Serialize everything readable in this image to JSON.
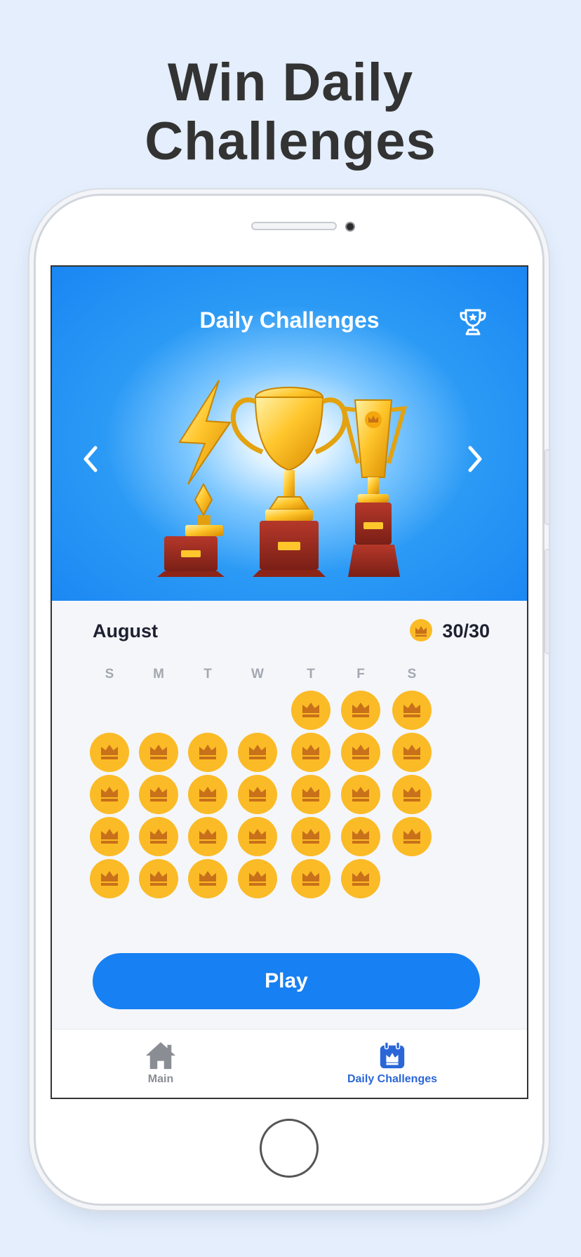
{
  "headline": {
    "line1": "Win Daily",
    "line2": "Challenges"
  },
  "screen": {
    "title": "Daily Challenges",
    "header_icon": "trophy-icon",
    "nav_prev_icon": "chevron-left-icon",
    "nav_next_icon": "chevron-right-icon"
  },
  "calendar": {
    "month": "August",
    "score": "30/30",
    "score_icon": "crown-coin-icon",
    "weekdays": [
      "S",
      "M",
      "T",
      "W",
      "T",
      "F",
      "S"
    ],
    "first_weekday_index": 4,
    "days_completed": 30,
    "day_icon": "crown-icon"
  },
  "play_button": {
    "label": "Play"
  },
  "tabbar": {
    "items": [
      {
        "label": "Main",
        "icon": "home-icon",
        "active": false
      },
      {
        "label": "Daily Challenges",
        "icon": "calendar-crown-icon",
        "active": true
      }
    ]
  },
  "colors": {
    "accent": "#1780f2",
    "coin": "#fbbb26",
    "crown": "#c8701a",
    "active_tab": "#2a66d8",
    "inactive_tab": "#8a8d93",
    "page_background": "#e4eefc"
  }
}
